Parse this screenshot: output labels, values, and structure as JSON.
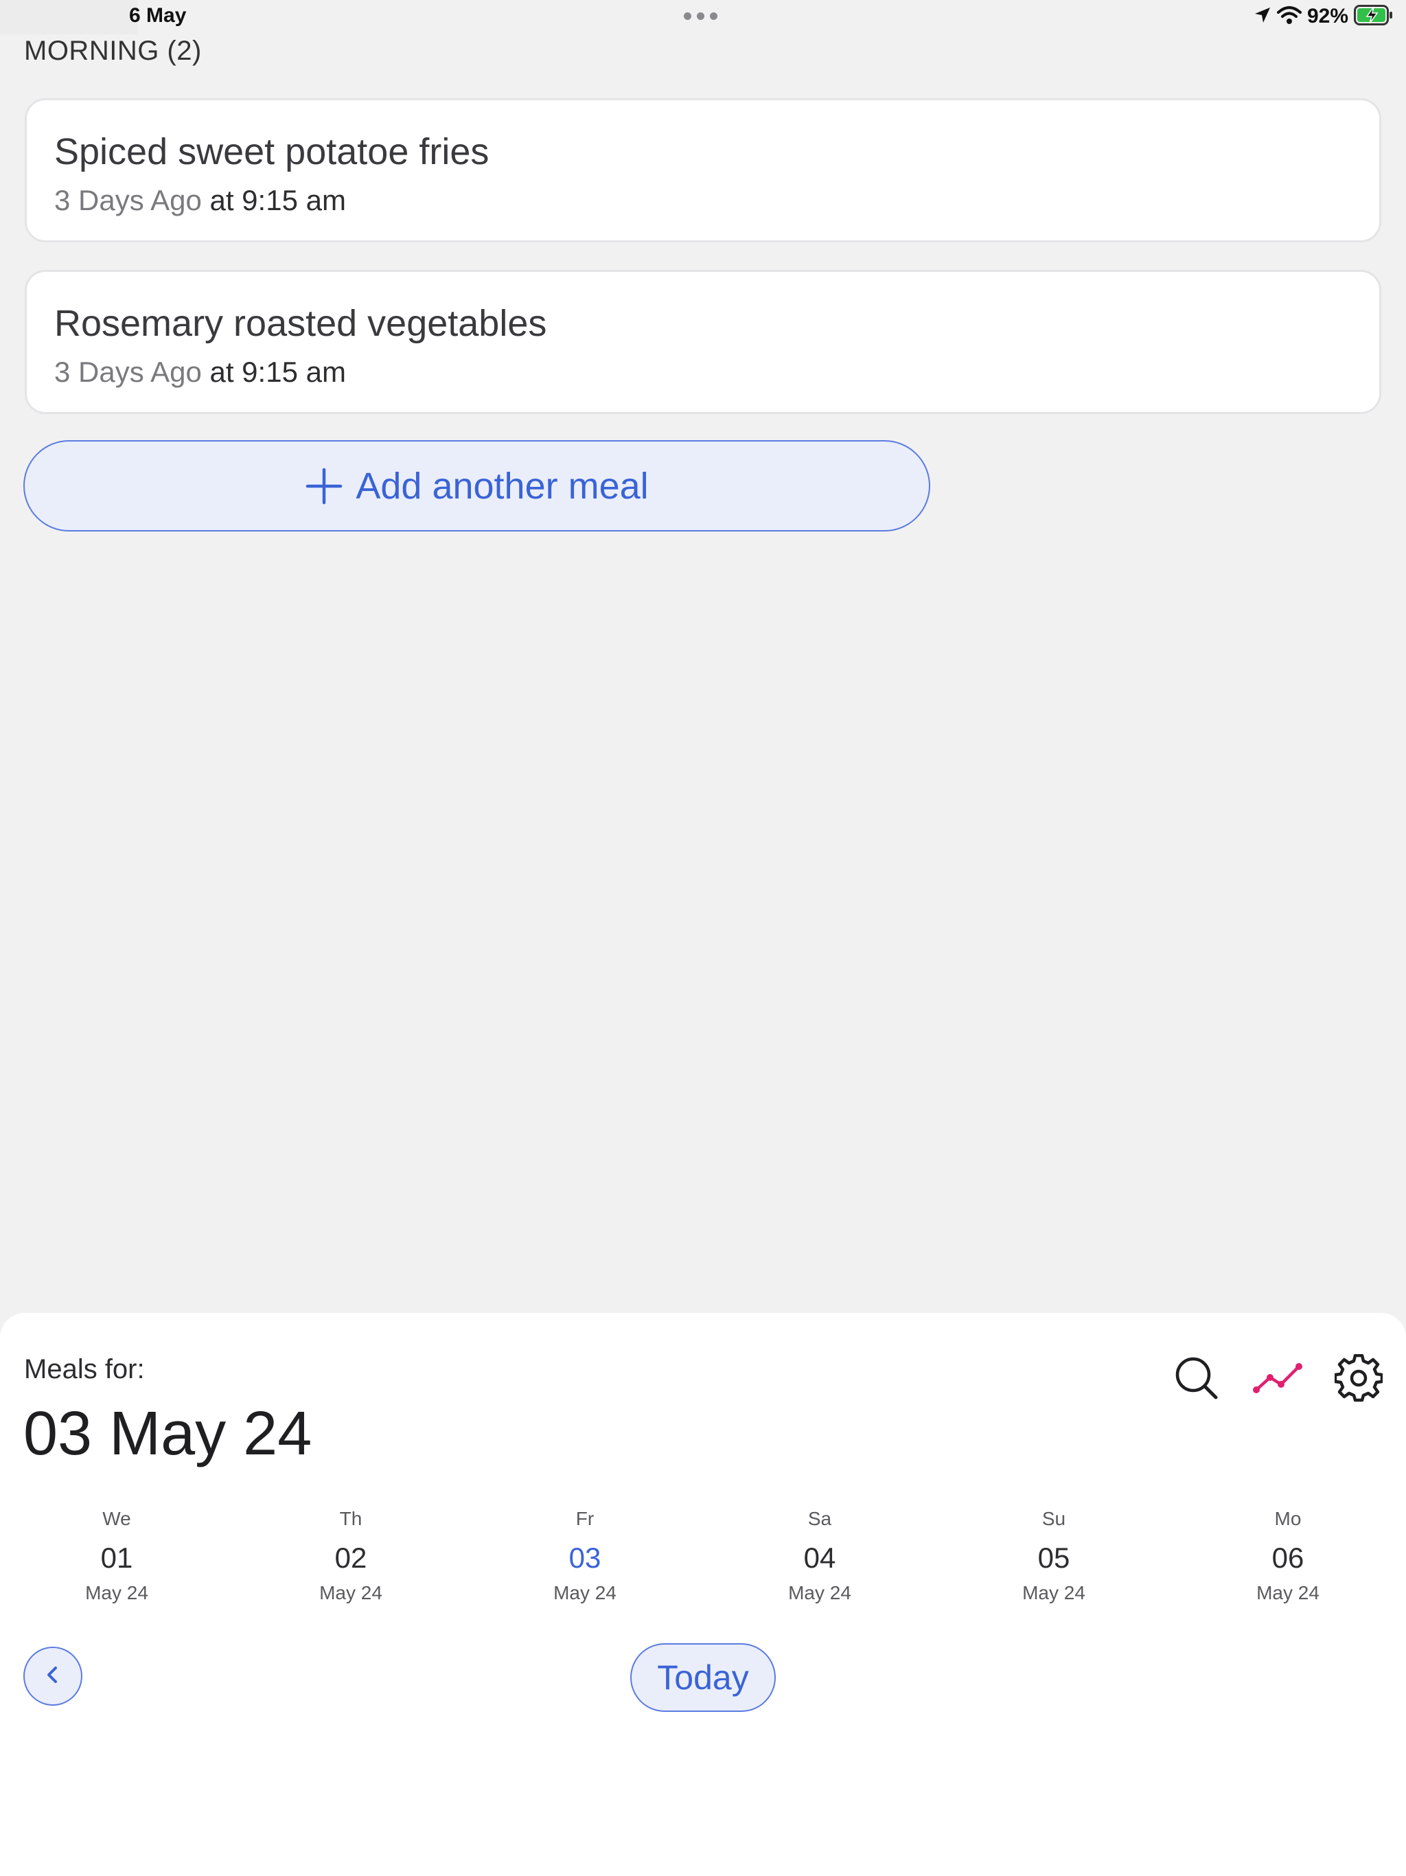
{
  "status_bar": {
    "date": "6 May",
    "battery_percent": "92%"
  },
  "section": {
    "title": "MORNING (2)"
  },
  "meals": [
    {
      "name": "Spiced sweet potatoe fries",
      "relative": "3 Days Ago",
      "time": "at 9:15 am"
    },
    {
      "name": "Rosemary roasted vegetables",
      "relative": "3 Days Ago",
      "time": "at 9:15 am"
    }
  ],
  "add_meal": {
    "label": "Add another meal",
    "icon": "plus-icon"
  },
  "sheet": {
    "meals_for_label": "Meals for:",
    "current_date": "03 May 24",
    "toolbar": [
      {
        "icon": "search-icon"
      },
      {
        "icon": "trend-chart-icon",
        "color": "#e0206f"
      },
      {
        "icon": "gear-icon"
      }
    ],
    "days": [
      {
        "dow": "We",
        "num": "01",
        "mon": "May 24",
        "selected": false
      },
      {
        "dow": "Th",
        "num": "02",
        "mon": "May 24",
        "selected": false
      },
      {
        "dow": "Fr",
        "num": "03",
        "mon": "May 24",
        "selected": true
      },
      {
        "dow": "Sa",
        "num": "04",
        "mon": "May 24",
        "selected": false
      },
      {
        "dow": "Su",
        "num": "05",
        "mon": "May 24",
        "selected": false
      },
      {
        "dow": "Mo",
        "num": "06",
        "mon": "May 24",
        "selected": false
      }
    ],
    "today_label": "Today",
    "prev_icon": "chevron-left-icon"
  },
  "colors": {
    "accent": "#3a63d6",
    "accent_bg": "#eaeefb",
    "background": "#f1f1f2",
    "trend": "#e0206f"
  }
}
